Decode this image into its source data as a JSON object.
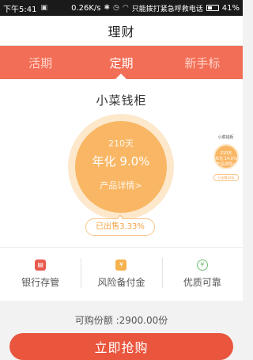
{
  "status_bar": {
    "time": "下午5:41",
    "speed": "0.26K/s",
    "carrier": "只能拨打紧急呼救电话",
    "battery": "41%"
  },
  "header": {
    "title": "理财"
  },
  "tabs": [
    {
      "label": "活期",
      "active": false
    },
    {
      "label": "定期",
      "active": true
    },
    {
      "label": "新手标",
      "active": false
    }
  ],
  "product": {
    "name": "小菜钱柜",
    "days": "210天",
    "rate": "年化 9.0%",
    "detail_link": "产品详情>",
    "sold": "已出售3.33%"
  },
  "mini_product": {
    "name": "小菜钱柜",
    "days": "210天",
    "rate": "年化 14.0%",
    "detail": "产品详情>",
    "sold": "已出售32%"
  },
  "features": [
    {
      "icon": "bank-safe-icon",
      "label": "银行存管"
    },
    {
      "icon": "reserve-fund-icon",
      "label": "风险备付金"
    },
    {
      "icon": "quality-badge-icon",
      "label": "优质可靠"
    }
  ],
  "footer": {
    "available": "可购份额 :2900.00份",
    "buy_button": "立即抢购"
  },
  "colors": {
    "tab_bar": "#f26e56",
    "circle": "#f9b765",
    "buy_button": "#e9553d"
  }
}
